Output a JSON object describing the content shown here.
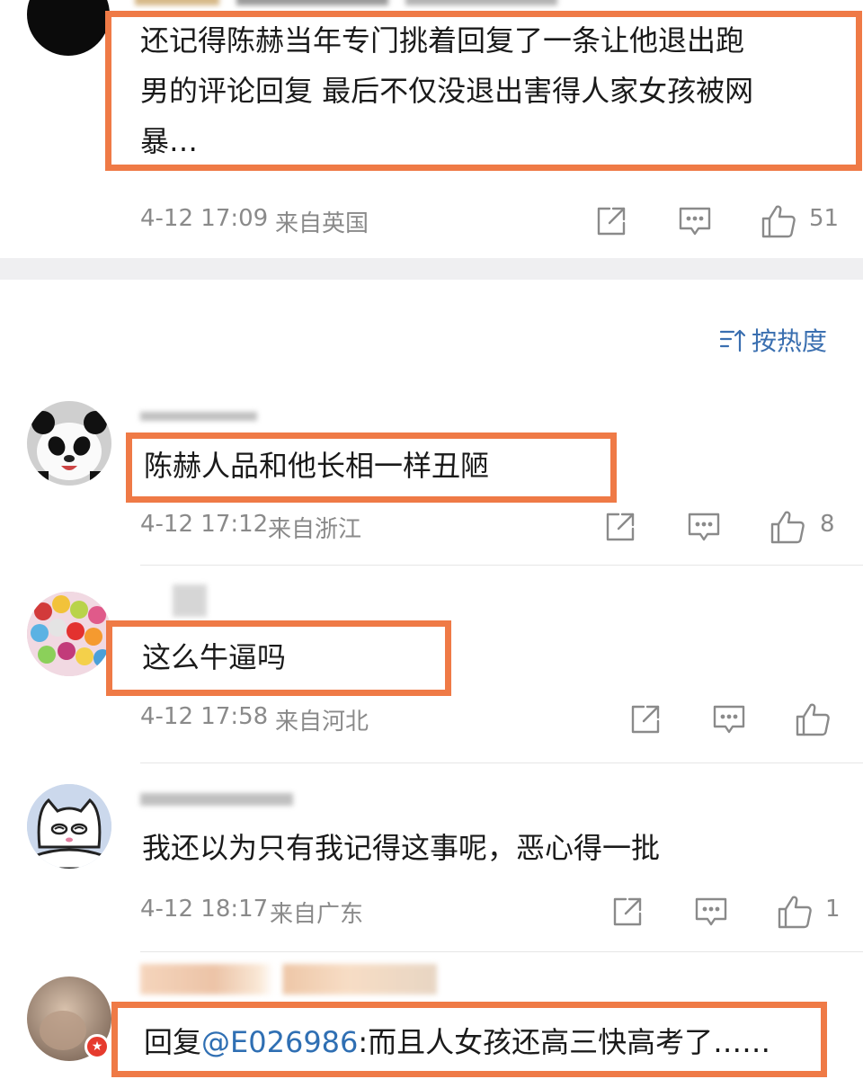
{
  "colors": {
    "highlight": "#ef7a46",
    "meta_text": "#8a8a8a",
    "link": "#2f6fb3",
    "separator": "#efeff1"
  },
  "top_comment": {
    "text_line1": "还记得陈赫当年专门挑着回复了一条让他退出跑",
    "text_line2": "男的评论回复 最后不仅没退出害得人家女孩被网",
    "text_line3": "暴…",
    "time": "4-12 17:09",
    "location": "来自英国",
    "likes": "51"
  },
  "sort": {
    "label": "按热度",
    "icon": "sort-icon"
  },
  "comments": [
    {
      "avatar": "panda-avatar",
      "text": "陈赫人品和他长相一样丑陋",
      "time": "4-12 17:12",
      "location": "来自浙江",
      "likes": "8"
    },
    {
      "avatar": "balloons-avatar",
      "text": "这么牛逼吗",
      "time": "4-12 17:58",
      "location": "来自河北",
      "likes": ""
    },
    {
      "avatar": "cat-avatar",
      "text": "我还以为只有我记得这事呢，恶心得一批",
      "time": "4-12 18:17",
      "location": "来自广东",
      "likes": "1"
    },
    {
      "avatar": "photo-avatar",
      "reply_prefix": "回复",
      "mention": "@E026986",
      "text": ":而且人女孩还高三快高考了……"
    }
  ],
  "icons": {
    "share": "share-icon",
    "comment": "comment-icon",
    "like": "thumbs-up-icon"
  }
}
